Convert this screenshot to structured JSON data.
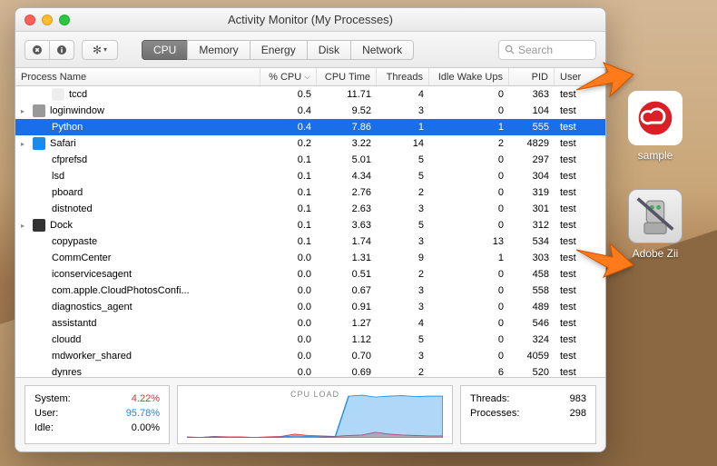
{
  "window_title": "Activity Monitor (My Processes)",
  "tabs": [
    {
      "label": "CPU",
      "active": true
    },
    {
      "label": "Memory",
      "active": false
    },
    {
      "label": "Energy",
      "active": false
    },
    {
      "label": "Disk",
      "active": false
    },
    {
      "label": "Network",
      "active": false
    }
  ],
  "search_placeholder": "Search",
  "columns": {
    "name": "Process Name",
    "cpu": "% CPU",
    "time": "CPU Time",
    "threads": "Threads",
    "idle": "Idle Wake Ups",
    "pid": "PID",
    "user": "User"
  },
  "processes": [
    {
      "name": "tccd",
      "cpu": "0.5",
      "time": "11.71",
      "threads": "4",
      "idle": "0",
      "pid": "363",
      "user": "test",
      "icon": "blank",
      "indent": 1
    },
    {
      "name": "loginwindow",
      "cpu": "0.4",
      "time": "9.52",
      "threads": "3",
      "idle": "0",
      "pid": "104",
      "user": "test",
      "icon": "gear",
      "indent": 0,
      "expand": true
    },
    {
      "name": "Python",
      "cpu": "0.4",
      "time": "7.86",
      "threads": "1",
      "idle": "1",
      "pid": "555",
      "user": "test",
      "icon": "none",
      "indent": 1,
      "selected": true
    },
    {
      "name": "Safari",
      "cpu": "0.2",
      "time": "3.22",
      "threads": "14",
      "idle": "2",
      "pid": "4829",
      "user": "test",
      "icon": "safari",
      "indent": 0,
      "expand": true
    },
    {
      "name": "cfprefsd",
      "cpu": "0.1",
      "time": "5.01",
      "threads": "5",
      "idle": "0",
      "pid": "297",
      "user": "test",
      "icon": "none",
      "indent": 1
    },
    {
      "name": "lsd",
      "cpu": "0.1",
      "time": "4.34",
      "threads": "5",
      "idle": "0",
      "pid": "304",
      "user": "test",
      "icon": "none",
      "indent": 1
    },
    {
      "name": "pboard",
      "cpu": "0.1",
      "time": "2.76",
      "threads": "2",
      "idle": "0",
      "pid": "319",
      "user": "test",
      "icon": "none",
      "indent": 1
    },
    {
      "name": "distnoted",
      "cpu": "0.1",
      "time": "2.63",
      "threads": "3",
      "idle": "0",
      "pid": "301",
      "user": "test",
      "icon": "none",
      "indent": 1
    },
    {
      "name": "Dock",
      "cpu": "0.1",
      "time": "3.63",
      "threads": "5",
      "idle": "0",
      "pid": "312",
      "user": "test",
      "icon": "dock",
      "indent": 0,
      "expand": true
    },
    {
      "name": "copypaste",
      "cpu": "0.1",
      "time": "1.74",
      "threads": "3",
      "idle": "13",
      "pid": "534",
      "user": "test",
      "icon": "none",
      "indent": 1
    },
    {
      "name": "CommCenter",
      "cpu": "0.0",
      "time": "1.31",
      "threads": "9",
      "idle": "1",
      "pid": "303",
      "user": "test",
      "icon": "none",
      "indent": 1
    },
    {
      "name": "iconservicesagent",
      "cpu": "0.0",
      "time": "0.51",
      "threads": "2",
      "idle": "0",
      "pid": "458",
      "user": "test",
      "icon": "none",
      "indent": 1
    },
    {
      "name": "com.apple.CloudPhotosConfi...",
      "cpu": "0.0",
      "time": "0.67",
      "threads": "3",
      "idle": "0",
      "pid": "558",
      "user": "test",
      "icon": "none",
      "indent": 1
    },
    {
      "name": "diagnostics_agent",
      "cpu": "0.0",
      "time": "0.91",
      "threads": "3",
      "idle": "0",
      "pid": "489",
      "user": "test",
      "icon": "none",
      "indent": 1
    },
    {
      "name": "assistantd",
      "cpu": "0.0",
      "time": "1.27",
      "threads": "4",
      "idle": "0",
      "pid": "546",
      "user": "test",
      "icon": "none",
      "indent": 1
    },
    {
      "name": "cloudd",
      "cpu": "0.0",
      "time": "1.12",
      "threads": "5",
      "idle": "0",
      "pid": "324",
      "user": "test",
      "icon": "none",
      "indent": 1
    },
    {
      "name": "mdworker_shared",
      "cpu": "0.0",
      "time": "0.70",
      "threads": "3",
      "idle": "0",
      "pid": "4059",
      "user": "test",
      "icon": "none",
      "indent": 1
    },
    {
      "name": "dynres",
      "cpu": "0.0",
      "time": "0.69",
      "threads": "2",
      "idle": "6",
      "pid": "520",
      "user": "test",
      "icon": "none",
      "indent": 1
    }
  ],
  "footer": {
    "system_label": "System:",
    "system_val": "4.22%",
    "user_label": "User:",
    "user_val": "95.78%",
    "idle_label": "Idle:",
    "idle_val": "0.00%",
    "chart_label": "CPU LOAD",
    "threads_label": "Threads:",
    "threads_val": "983",
    "processes_label": "Processes:",
    "processes_val": "298"
  },
  "desktop": {
    "sample_label": "sample",
    "zii_label": "Adobe Zii"
  },
  "chart_data": {
    "type": "area",
    "title": "CPU LOAD",
    "ylim": [
      0,
      100
    ],
    "series": [
      {
        "name": "System",
        "color": "#e83030",
        "values": [
          2,
          1,
          3,
          2,
          2,
          1,
          2,
          3,
          8,
          5,
          4,
          3,
          5,
          6,
          12,
          8,
          6,
          5,
          4,
          4
        ]
      },
      {
        "name": "User",
        "color": "#1a8be8",
        "values": [
          1,
          1,
          2,
          1,
          1,
          1,
          1,
          2,
          4,
          3,
          2,
          2,
          90,
          92,
          88,
          90,
          91,
          89,
          90,
          90
        ]
      }
    ]
  }
}
